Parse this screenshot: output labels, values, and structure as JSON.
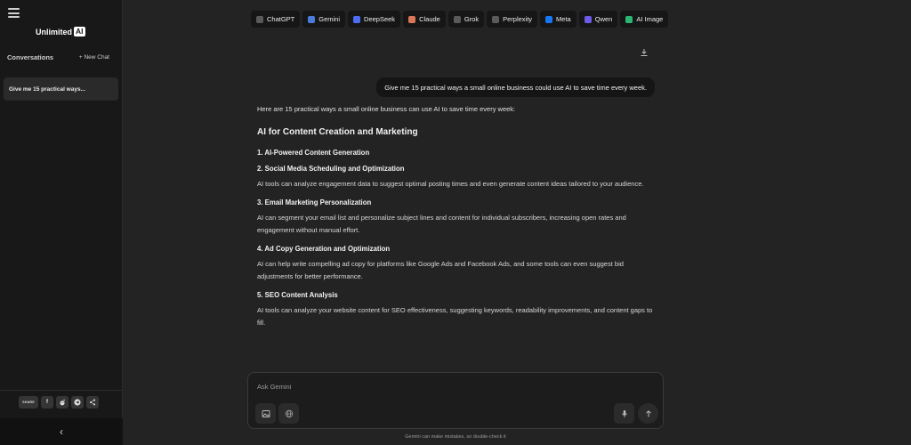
{
  "sidebar": {
    "logo_text": "Unlimited",
    "logo_badge": "AI",
    "conversations_title": "Conversations",
    "new_chat_label": "+ New Chat",
    "conversation_items": [
      "Give me 15 practical ways..."
    ],
    "share_label": "SHARE",
    "share_buttons": [
      "f",
      "reddit-icon",
      "telegram-icon",
      "share-icon"
    ],
    "collapse_glyph": "‹"
  },
  "tabs": [
    {
      "label": "ChatGPT",
      "icon": "chatgpt-icon",
      "color": "#5a5a5a"
    },
    {
      "label": "Gemini",
      "icon": "gemini-icon",
      "color": "#4b7bd9"
    },
    {
      "label": "DeepSeek",
      "icon": "deepseek-icon",
      "color": "#4c6ef5"
    },
    {
      "label": "Claude",
      "icon": "claude-icon",
      "color": "#d97757"
    },
    {
      "label": "Grok",
      "icon": "grok-icon",
      "color": "#5a5a5a"
    },
    {
      "label": "Perplexity",
      "icon": "perplexity-icon",
      "color": "#5a5a5a"
    },
    {
      "label": "Meta",
      "icon": "meta-icon",
      "color": "#1877f2"
    },
    {
      "label": "Qwen",
      "icon": "qwen-icon",
      "color": "#6c5ce7"
    },
    {
      "label": "AI Image",
      "icon": "ai-image-icon",
      "color": "#2bb673"
    }
  ],
  "chat": {
    "user_message": "Give me 15 practical ways a small online business could use AI to save time every week.",
    "answer_intro": "Here are 15 practical ways a small online business can use AI to save time every week:",
    "section_title": "AI for Content Creation and Marketing",
    "items": [
      {
        "title": "1. AI-Powered Content Generation",
        "body": ""
      },
      {
        "title": "2. Social Media Scheduling and Optimization",
        "body": "AI tools can analyze engagement data to suggest optimal posting times and even generate content ideas tailored to your audience."
      },
      {
        "title": "3. Email Marketing Personalization",
        "body": "AI can segment your email list and personalize subject lines and content for individual subscribers, increasing open rates and engagement without manual effort."
      },
      {
        "title": "4. Ad Copy Generation and Optimization",
        "body": "AI can help write compelling ad copy for platforms like Google Ads and Facebook Ads, and some tools can even suggest bid adjustments for better performance."
      },
      {
        "title": "5. SEO Content Analysis",
        "body": "AI tools can analyze your website content for SEO effectiveness, suggesting keywords, readability improvements, and content gaps to fill."
      }
    ]
  },
  "input": {
    "placeholder": "Ask Gemini",
    "disclaimer": "Gemini can make mistakes, so double-check it"
  }
}
